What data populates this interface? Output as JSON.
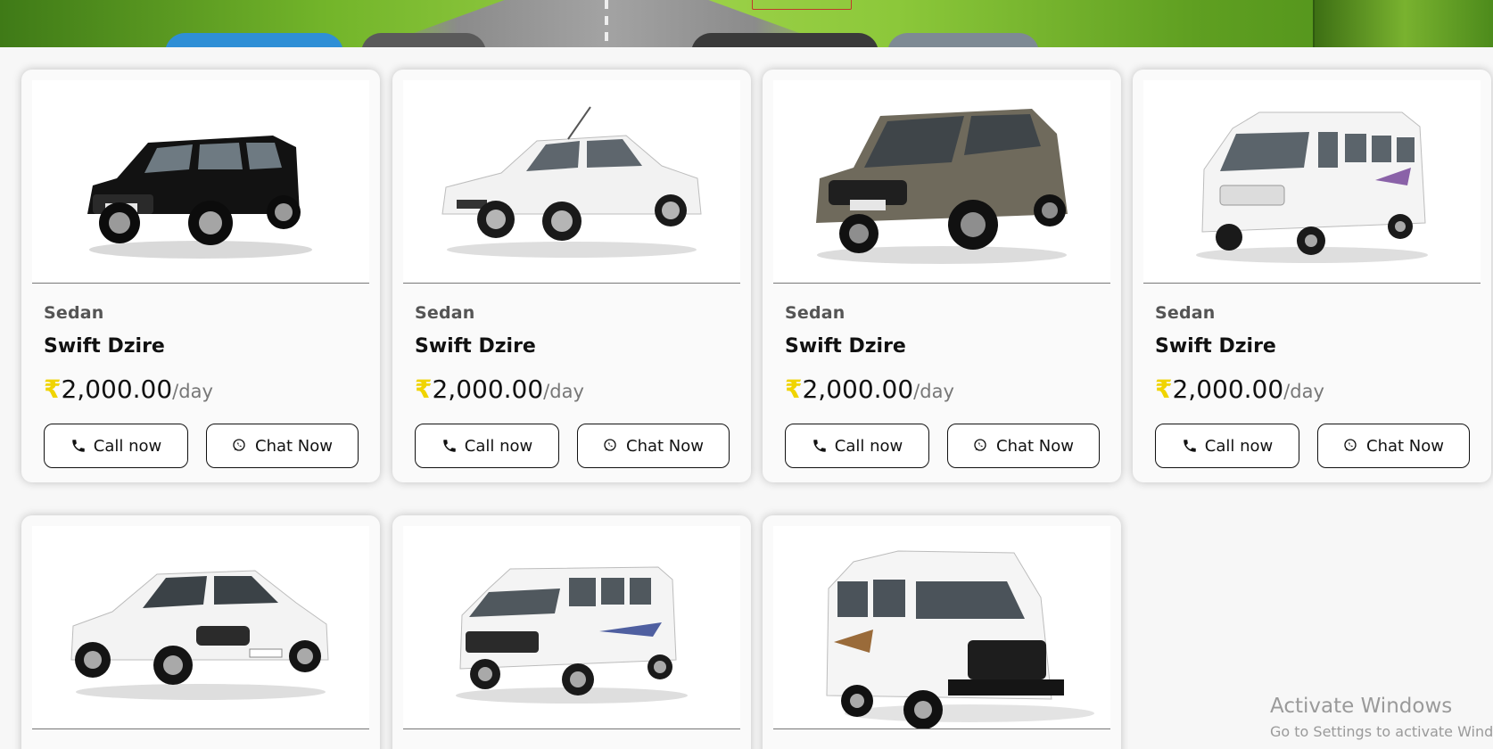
{
  "colors": {
    "page_background": "#f7f7f7",
    "card_background": "#fafafa",
    "price_currency": "#f0d400",
    "text_dark": "#111111",
    "text_muted": "#777777"
  },
  "hero": {
    "image": "highway-with-cars-banner"
  },
  "cards": [
    {
      "category": "Sedan",
      "name": "Swift Dzire",
      "currency": "₹",
      "amount": "2,000.00",
      "unit": "/day",
      "call_label": "Call now",
      "chat_label": "Chat Now",
      "vehicle": "black-suv"
    },
    {
      "category": "Sedan",
      "name": "Swift Dzire",
      "currency": "₹",
      "amount": "2,000.00",
      "unit": "/day",
      "call_label": "Call now",
      "chat_label": "Chat Now",
      "vehicle": "white-sedan"
    },
    {
      "category": "Sedan",
      "name": "Swift Dzire",
      "currency": "₹",
      "amount": "2,000.00",
      "unit": "/day",
      "call_label": "Call now",
      "chat_label": "Chat Now",
      "vehicle": "bronze-mpv"
    },
    {
      "category": "Sedan",
      "name": "Swift Dzire",
      "currency": "₹",
      "amount": "2,000.00",
      "unit": "/day",
      "call_label": "Call now",
      "chat_label": "Chat Now",
      "vehicle": "white-traveller-van"
    },
    {
      "vehicle": "white-hatch-sedan"
    },
    {
      "vehicle": "white-winger-van"
    },
    {
      "vehicle": "white-force-van"
    }
  ],
  "icons": {
    "call": "phone-icon",
    "chat": "whatsapp-icon"
  },
  "watermark": {
    "line1": "Activate Windows",
    "line2": "Go to Settings to activate Wind"
  }
}
